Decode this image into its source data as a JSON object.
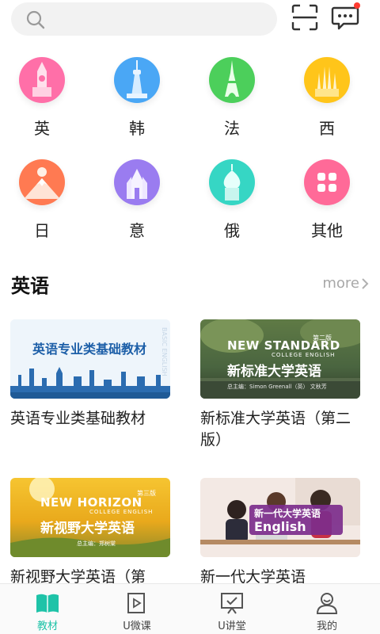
{
  "search": {
    "icon": "search-icon"
  },
  "header_icons": {
    "scan": "scan-icon",
    "messages": "message-icon",
    "badge_color": "#ff3b30"
  },
  "languages": [
    {
      "label": "英",
      "icon": "big-ben-icon",
      "color": "#ff6fa8"
    },
    {
      "label": "韩",
      "icon": "seoul-tower-icon",
      "color": "#4aa7f5"
    },
    {
      "label": "法",
      "icon": "eiffel-tower-icon",
      "color": "#4ccf5b"
    },
    {
      "label": "西",
      "icon": "sagrada-familia-icon",
      "color": "#ffc51a"
    },
    {
      "label": "日",
      "icon": "mount-fuji-icon",
      "color": "#ff7a52"
    },
    {
      "label": "意",
      "icon": "cathedral-icon",
      "color": "#9a7cf0"
    },
    {
      "label": "俄",
      "icon": "onion-dome-icon",
      "color": "#36d6c4"
    },
    {
      "label": "其他",
      "icon": "grid-icon",
      "color": "#ff6a98"
    }
  ],
  "section": {
    "title": "英语",
    "more": "more"
  },
  "books": [
    {
      "title": "英语专业类基础教材",
      "cover_text": "英语专业类基础教材",
      "cover_side_text": "BASIC ENGLISH"
    },
    {
      "title": "新标准大学英语（第二版）",
      "cover_brand": "NEW STANDARD",
      "cover_sub": "COLLEGE ENGLISH",
      "cover_cn": "新标准大学英语",
      "cover_edition": "第二版",
      "cover_author": "总主编：Simon Greenall（英） 文秋芳"
    },
    {
      "title": "新视野大学英语（第",
      "cover_brand": "NEW HORIZON",
      "cover_sub": "COLLEGE ENGLISH",
      "cover_cn": "新视野大学英语",
      "cover_edition": "第三版",
      "cover_author": "总主编：郑树棠"
    },
    {
      "title": "新一代大学英语",
      "cover_cn": "新一代大学英语",
      "cover_en": "English"
    }
  ],
  "nav": [
    {
      "label": "教材",
      "icon": "book-icon",
      "active": true
    },
    {
      "label": "U微课",
      "icon": "video-play-icon",
      "active": false
    },
    {
      "label": "U讲堂",
      "icon": "lecture-screen-icon",
      "active": false
    },
    {
      "label": "我的",
      "icon": "user-icon",
      "active": false
    }
  ],
  "accent_color": "#1ec3a8"
}
